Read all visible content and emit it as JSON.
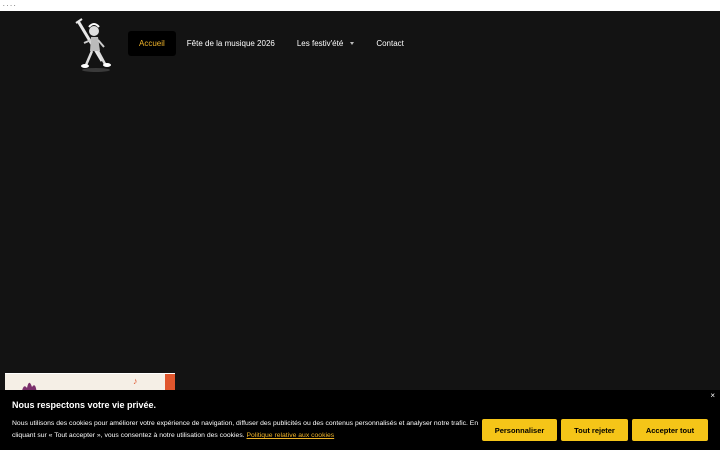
{
  "topstrip": {
    "text": "...."
  },
  "logo": {
    "icon": "bassoonist-illustration-icon"
  },
  "nav": {
    "items": [
      {
        "label": "Accueil",
        "active": true
      },
      {
        "label": "Fête de la musique 2026",
        "active": false
      },
      {
        "label": "Les festiv'été",
        "active": false,
        "has_dropdown": true
      },
      {
        "label": "Contact",
        "active": false
      }
    ]
  },
  "thumbnail": {
    "note": "♪"
  },
  "cookie_banner": {
    "close": "×",
    "title": "Nous respectons votre vie privée.",
    "text": "Nous utilisons des cookies pour améliorer votre expérience de navigation, diffuser des publicités ou des contenus personnalisés et analyser notre trafic. En cliquant sur « Tout accepter », vous consentez à notre utilisation des cookies. ",
    "link": "Politique relative aux cookies",
    "buttons": {
      "customize": "Personnaliser",
      "reject": "Tout rejeter",
      "accept": "Accepter tout"
    }
  },
  "colors": {
    "background": "#131313",
    "accent": "#f0b429",
    "button": "#f5c518"
  }
}
